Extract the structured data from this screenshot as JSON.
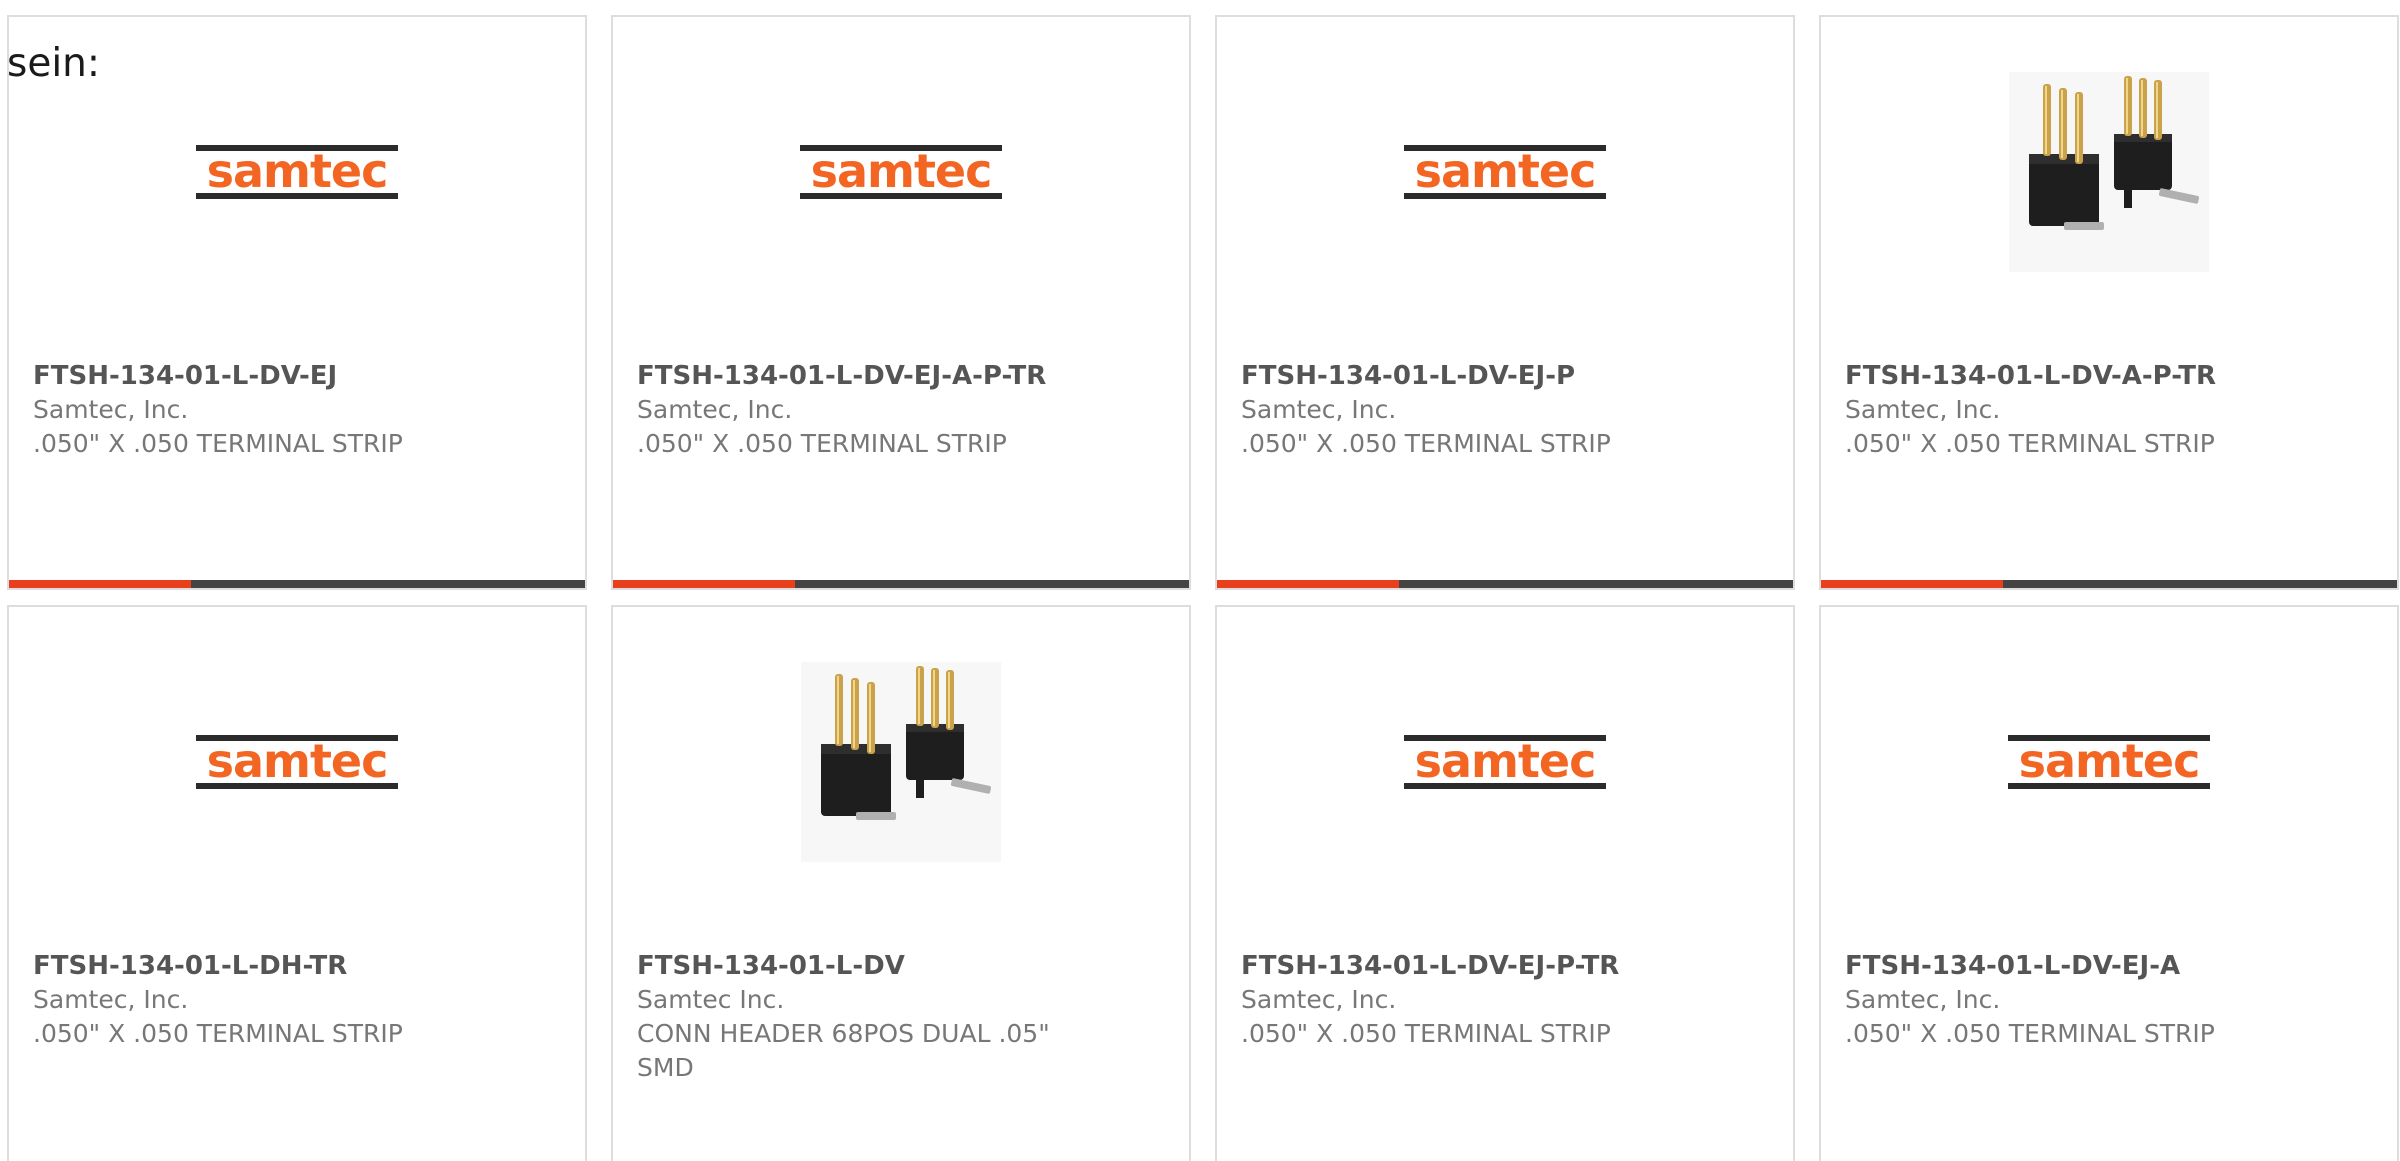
{
  "intro_text": "sein:",
  "colors": {
    "accent": "#e8401c",
    "bar": "#444444",
    "logo_orange": "#f26522",
    "logo_dark": "#2b2b2b"
  },
  "logo_text": "samtec",
  "cards": [
    {
      "part": "FTSH-134-01-L-DV-EJ",
      "manufacturer": "Samtec, Inc.",
      "description": ".050\" X .050 TERMINAL STRIP",
      "image": "samtec-logo"
    },
    {
      "part": "FTSH-134-01-L-DV-EJ-A-P-TR",
      "manufacturer": "Samtec, Inc.",
      "description": ".050\" X .050 TERMINAL STRIP",
      "image": "samtec-logo"
    },
    {
      "part": "FTSH-134-01-L-DV-EJ-P",
      "manufacturer": "Samtec, Inc.",
      "description": ".050\" X .050 TERMINAL STRIP",
      "image": "samtec-logo"
    },
    {
      "part": "FTSH-134-01-L-DV-A-P-TR",
      "manufacturer": "Samtec, Inc.",
      "description": ".050\" X .050 TERMINAL STRIP",
      "image": "header-connector-photo"
    },
    {
      "part": "FTSH-134-01-L-DH-TR",
      "manufacturer": "Samtec, Inc.",
      "description": ".050\" X .050 TERMINAL STRIP",
      "image": "samtec-logo"
    },
    {
      "part": "FTSH-134-01-L-DV",
      "manufacturer": "Samtec Inc.",
      "description": "CONN HEADER 68POS DUAL .05\" SMD",
      "image": "header-connector-photo"
    },
    {
      "part": "FTSH-134-01-L-DV-EJ-P-TR",
      "manufacturer": "Samtec, Inc.",
      "description": ".050\" X .050 TERMINAL STRIP",
      "image": "samtec-logo"
    },
    {
      "part": "FTSH-134-01-L-DV-EJ-A",
      "manufacturer": "Samtec, Inc.",
      "description": ".050\" X .050 TERMINAL STRIP",
      "image": "samtec-logo"
    }
  ]
}
